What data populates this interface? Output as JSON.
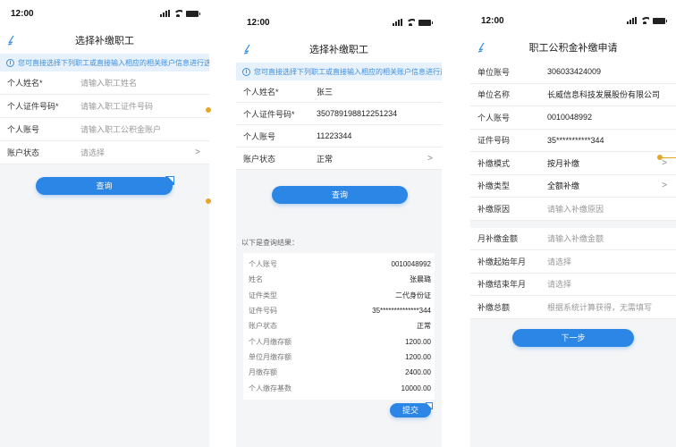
{
  "statusbar": {
    "time": "12:00"
  },
  "screen1": {
    "title": "选择补缴职工",
    "notice": "您可直接选择下列职工或直接输入相应的相关账户信息进行选择",
    "fields": [
      {
        "label": "个人姓名*",
        "placeholder": "请输入职工姓名"
      },
      {
        "label": "个人证件号码*",
        "placeholder": "请输入职工证件号码"
      },
      {
        "label": "个人账号",
        "placeholder": "请输入职工公积金账户"
      },
      {
        "label": "账户状态",
        "placeholder": "请选择"
      }
    ],
    "query_button": "查询"
  },
  "screen2": {
    "title": "选择补缴职工",
    "notice": "您可直接选择下列职工或直接输入相应的相关账户信息进行选择",
    "fields": [
      {
        "label": "个人姓名*",
        "value": "张三"
      },
      {
        "label": "个人证件号码*",
        "value": "350789198812251234"
      },
      {
        "label": "个人账号",
        "value": "11223344"
      },
      {
        "label": "账户状态",
        "value": "正常"
      }
    ],
    "query_button": "查询",
    "results_title": "以下是查询结果：",
    "results": [
      {
        "label": "个人账号",
        "value": "0010048992"
      },
      {
        "label": "姓名",
        "value": "张晨璐"
      },
      {
        "label": "证件类型",
        "value": "二代身份证"
      },
      {
        "label": "证件号码",
        "value": "35**************344"
      },
      {
        "label": "账户状态",
        "value": "正常"
      },
      {
        "label": "个人月缴存额",
        "value": "1200.00"
      },
      {
        "label": "单位月缴存额",
        "value": "1200.00"
      },
      {
        "label": "月缴存额",
        "value": "2400.00"
      },
      {
        "label": "个人缴存基数",
        "value": "10000.00"
      }
    ],
    "submit_button": "提交"
  },
  "screen3": {
    "title": "职工公积金补缴申请",
    "rows": [
      {
        "label": "单位账号",
        "value": "306033424009"
      },
      {
        "label": "单位名称",
        "value": "长威信息科技发展股份有限公司"
      },
      {
        "label": "个人账号",
        "value": "0010048992"
      },
      {
        "label": "证件号码",
        "value": "35***********344"
      },
      {
        "label": "补缴模式",
        "value": "按月补缴"
      },
      {
        "label": "补缴类型",
        "value": "全额补缴"
      },
      {
        "label": "补缴原因",
        "placeholder": "请输入补缴原因"
      }
    ],
    "rows2": [
      {
        "label": "月补缴金额",
        "placeholder": "请输入补缴金额"
      },
      {
        "label": "补缴起始年月",
        "placeholder": "请选择"
      },
      {
        "label": "补缴结束年月",
        "placeholder": "请选择"
      },
      {
        "label": "补缴总额",
        "placeholder": "根据系统计算获得，无需填写"
      }
    ],
    "next_button": "下一步"
  },
  "colors": {
    "accent": "#2b86e6",
    "notice_bg": "#e6f1fc",
    "marker": "#e8a628"
  },
  "icons": [
    "back-icon",
    "info-icon",
    "chevron-right-icon",
    "signal-icon",
    "wifi-icon",
    "battery-icon"
  ]
}
